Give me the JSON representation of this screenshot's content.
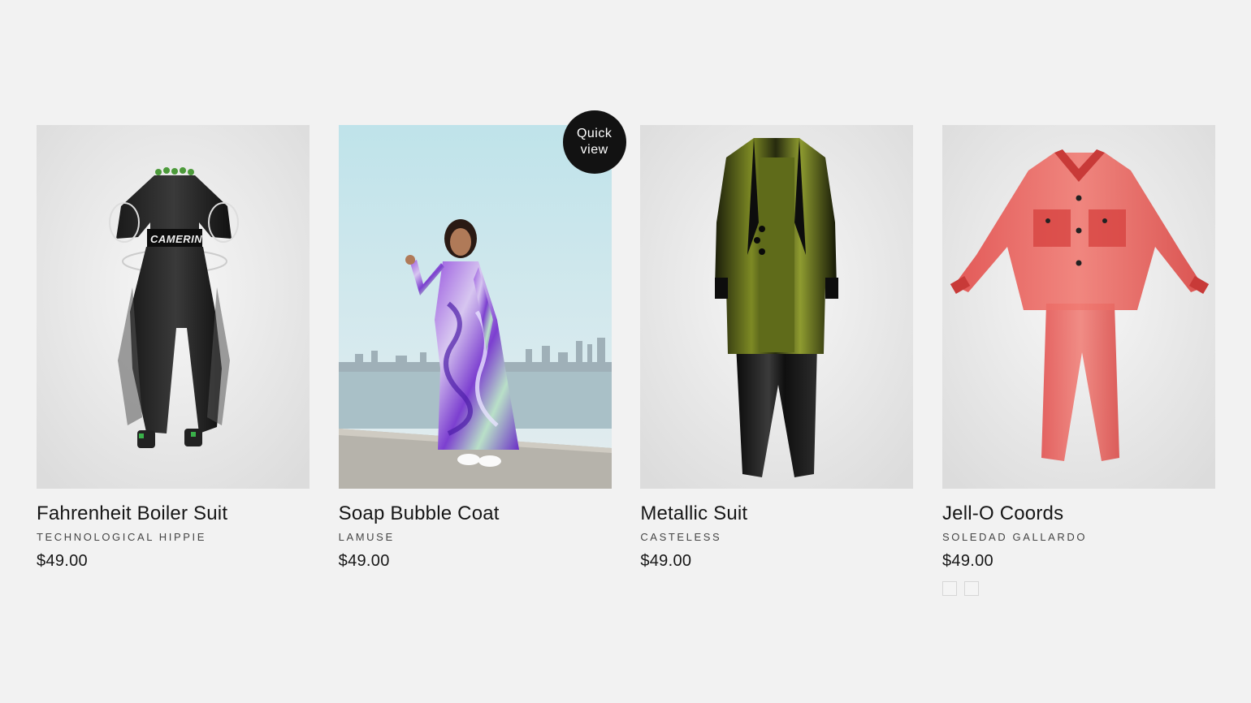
{
  "products": [
    {
      "title": "Fahrenheit Boiler Suit",
      "brand": "TECHNOLOGICAL HIPPIE",
      "price": "$49.00",
      "image": "black-boiler-suit-image",
      "garment_text": "CAMERINO"
    },
    {
      "title": "Soap Bubble Coat",
      "brand": "LAMUSE",
      "price": "$49.00",
      "image": "iridescent-coat-model-image",
      "quick_view": "Quick view"
    },
    {
      "title": "Metallic Suit",
      "brand": "CASTELESS",
      "price": "$49.00",
      "image": "metallic-coat-suit-image"
    },
    {
      "title": "Jell-O Coords",
      "brand": "SOLEDAD GALLARDO",
      "price": "$49.00",
      "image": "red-translucent-coords-image",
      "swatch_count": 2
    }
  ],
  "colors": {
    "background": "#f2f2f2",
    "text": "#161616",
    "quick_view_bg": "#121212",
    "metallic_olive": "#6e7a1e",
    "jello_red": "#e8524e",
    "soap_purple": "#8a3fd6"
  }
}
